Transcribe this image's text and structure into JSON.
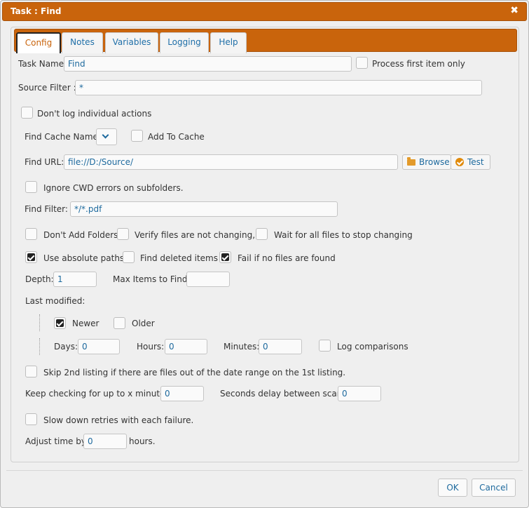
{
  "window": {
    "title": "Task : Find",
    "close_symbol": "✖"
  },
  "tabs": [
    {
      "label": "Config",
      "active": true
    },
    {
      "label": "Notes"
    },
    {
      "label": "Variables"
    },
    {
      "label": "Logging"
    },
    {
      "label": "Help"
    }
  ],
  "form": {
    "task_name_label": "Task Name:",
    "task_name_value": "Find",
    "process_first_label": "Process first item only",
    "process_first_checked": false,
    "source_filter_label": "Source Filter :",
    "source_filter_value": "*",
    "dont_log_label": "Don't log individual actions",
    "dont_log_checked": false,
    "find_cache_label": "Find Cache Name:",
    "find_cache_value": "",
    "add_to_cache_label": "Add To Cache",
    "add_to_cache_checked": false,
    "find_url_label": "Find URL:",
    "find_url_value": "file://D:/Source/",
    "browse_label": "Browse",
    "test_label": "Test",
    "ignore_cwd_label": "Ignore CWD errors on subfolders.",
    "ignore_cwd_checked": false,
    "find_filter_label": "Find Filter:",
    "find_filter_value": "*/*.pdf",
    "dont_add_folders_label": "Don't Add Folders",
    "dont_add_folders_checked": false,
    "verify_label": "Verify files are not changing,",
    "verify_checked": false,
    "wait_label": "Wait for all files to stop changing",
    "wait_checked": false,
    "absolute_paths_label": "Use absolute paths",
    "absolute_paths_checked": true,
    "find_deleted_label": "Find deleted items",
    "find_deleted_checked": false,
    "fail_if_none_label": "Fail if no files are found",
    "fail_if_none_checked": true,
    "depth_label": "Depth:",
    "depth_value": "1",
    "max_items_label": "Max Items to Find:",
    "max_items_value": "",
    "last_modified_label": "Last modified:",
    "newer_label": "Newer",
    "newer_checked": true,
    "older_label": "Older",
    "older_checked": false,
    "days_label": "Days:",
    "days_value": "0",
    "hours_label": "Hours:",
    "hours_value": "0",
    "minutes_label": "Minutes:",
    "minutes_value": "0",
    "log_comparisons_label": "Log comparisons",
    "log_comparisons_checked": false,
    "skip_2nd_label": "Skip 2nd listing if there are files out of the date range on the 1st listing.",
    "skip_2nd_checked": false,
    "keep_checking_label": "Keep checking for up to x minutes:",
    "keep_checking_value": "0",
    "seconds_delay_label": "Seconds delay between scans:",
    "seconds_delay_value": "0",
    "slow_down_label": "Slow down retries with each failure.",
    "slow_down_checked": false,
    "adjust_time_label": "Adjust time by",
    "adjust_time_value": "0",
    "hours_suffix": "hours."
  },
  "footer": {
    "ok_label": "OK",
    "cancel_label": "Cancel"
  },
  "colors": {
    "accent": "#c9640c",
    "link": "#1e6a9e",
    "background": "#efefef"
  }
}
